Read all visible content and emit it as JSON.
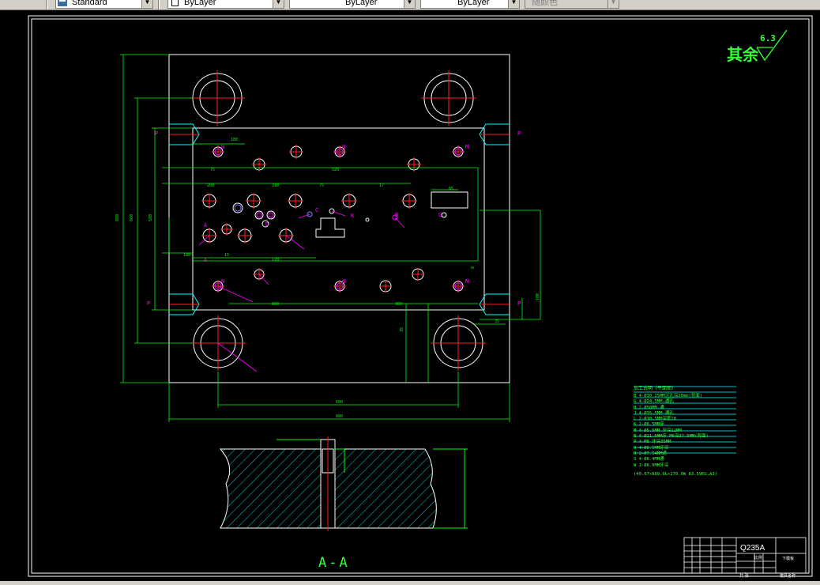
{
  "toolbar": {
    "text_style": "Standard",
    "layer": "ByLayer",
    "linetype": "ByLayer",
    "lineweight": "ByLayer",
    "plot_style": "随颜色"
  },
  "drawing": {
    "roughness_label": "其余",
    "roughness_value": "6.3",
    "section_label": "A-A",
    "point_marks": {
      "P": "P",
      "N": "N",
      "A": "A",
      "B": "B",
      "C": "C",
      "D": "D",
      "G": "G",
      "K": "K",
      "M": "M"
    },
    "notes": {
      "title": "加工说明（平面图）",
      "items": [
        "B  4-Ø30.25MM沉孔深20mm(背面)",
        "G  4-Ø24.5MM-通孔",
        "H  2-Ø50MM-通",
        "J  4-Ø35.5MM-通孔",
        "L  2-Ø10.5MM深度20",
        "K  2-Ø8.5MM穿",
        "M  4-Ø5.5MM-牙深12MM",
        "N  4-Ø21.5MM牙-M6深37.5MM(背面)",
        "P  4-M8-牙深35MM",
        "Q  4-Ø8.5MM牙深",
        "R  2-Ø7.54MM通",
        "S  4-Ø8.4MM通",
        "W  2-Ø8.0MM牙深"
      ],
      "footer": "(40.07×880.0L×270.0W  83.59KG,A3)"
    },
    "title_block": {
      "material": "Q235A",
      "part_name": "下模板",
      "drawing_no": "模具名称",
      "scale": "比例",
      "sheet": "共 张"
    }
  },
  "status": {
    "indicator": ""
  }
}
